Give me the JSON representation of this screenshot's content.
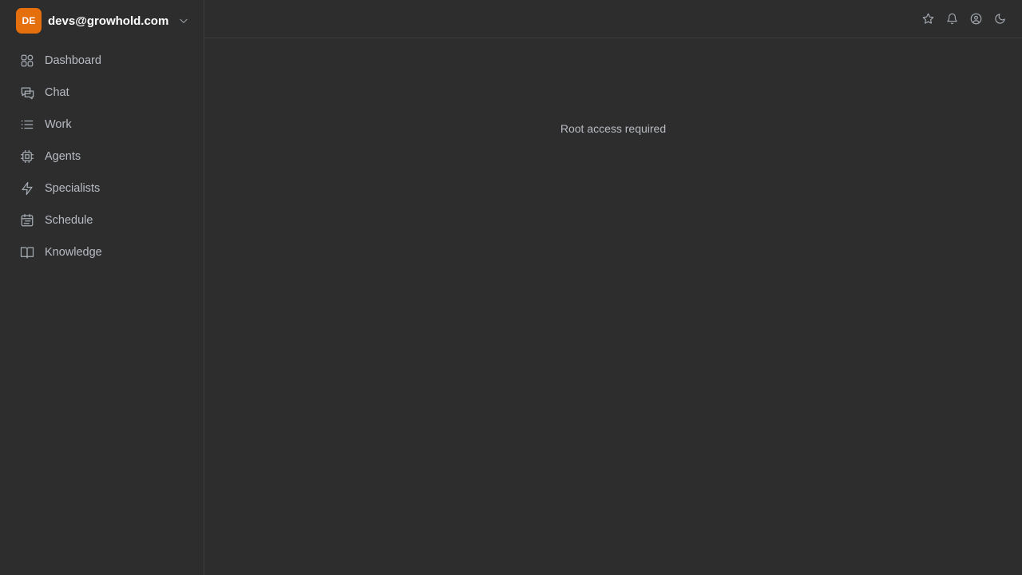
{
  "account": {
    "avatar_initials": "DE",
    "email": "devs@growhold.com",
    "avatar_color": "#e46f0c"
  },
  "sidebar": {
    "items": [
      {
        "label": "Dashboard",
        "icon": "dashboard-icon"
      },
      {
        "label": "Chat",
        "icon": "chat-icon"
      },
      {
        "label": "Work",
        "icon": "list-icon"
      },
      {
        "label": "Agents",
        "icon": "cpu-icon"
      },
      {
        "label": "Specialists",
        "icon": "lightning-icon"
      },
      {
        "label": "Schedule",
        "icon": "calendar-icon"
      },
      {
        "label": "Knowledge",
        "icon": "book-icon"
      }
    ]
  },
  "topbar": {
    "icons": [
      "star-icon",
      "bell-icon",
      "user-circle-icon",
      "moon-icon"
    ]
  },
  "main": {
    "message": "Root access required"
  },
  "colors": {
    "background": "#2d2d2d",
    "text_muted": "#b8bcc3",
    "border": "#3c3c3c"
  }
}
